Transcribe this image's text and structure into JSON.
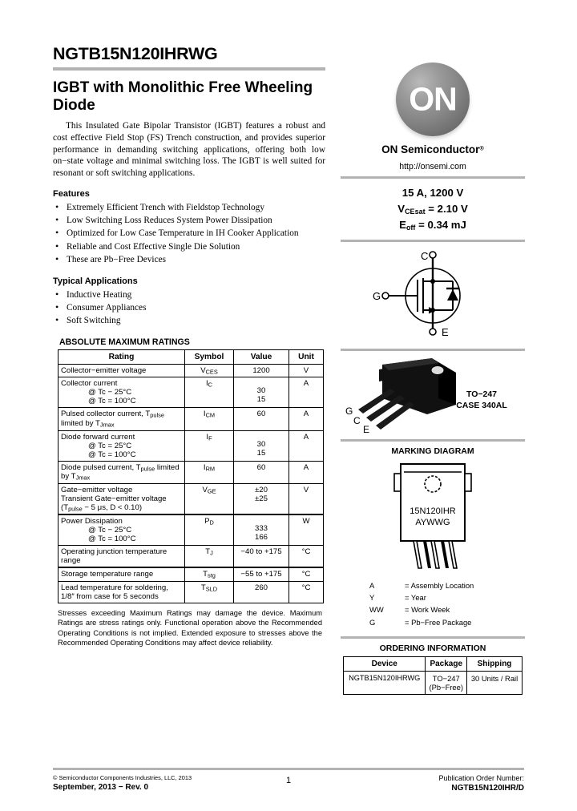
{
  "document": {
    "part_number": "NGTB15N120IHRWG",
    "title": "IGBT with Monolithic Free Wheeling Diode",
    "intro": "This Insulated Gate Bipolar Transistor (IGBT) features a robust and cost effective Field Stop (FS) Trench construction, and provides superior performance in demanding switching applications, offering both low on−state voltage and minimal switching loss. The IGBT is well suited for resonant or soft switching applications."
  },
  "features": {
    "heading": "Features",
    "items": [
      "Extremely Efficient Trench with Fieldstop Technology",
      "Low Switching Loss Reduces System Power Dissipation",
      "Optimized for Low Case Temperature in IH Cooker Application",
      "Reliable and Cost Effective Single Die Solution",
      "These are Pb−Free Devices"
    ]
  },
  "applications": {
    "heading": "Typical Applications",
    "items": [
      "Inductive Heating",
      "Consumer Appliances",
      "Soft Switching"
    ]
  },
  "ratings": {
    "heading": "ABSOLUTE MAXIMUM RATINGS",
    "columns": [
      "Rating",
      "Symbol",
      "Value",
      "Unit"
    ],
    "rows": [
      {
        "rating": "Collector−emitter voltage",
        "symbol_main": "V",
        "symbol_sub": "CES",
        "value": "1200",
        "unit": "V"
      },
      {
        "rating": "Collector current",
        "sub_lines": [
          "@ Tc − 25°C",
          "@ Tc = 100°C"
        ],
        "symbol_main": "I",
        "symbol_sub": "C",
        "values": [
          "30",
          "15"
        ],
        "unit": "A"
      },
      {
        "rating_pre": "Pulsed collector current, T",
        "rating_sub1": "pulse",
        "rating_mid": "limited by T",
        "rating_sub2": "Jmax",
        "symbol_main": "I",
        "symbol_sub": "CM",
        "value": "60",
        "unit": "A"
      },
      {
        "rating": "Diode forward current",
        "sub_lines": [
          "@ Tc = 25°C",
          "@ Tc = 100°C"
        ],
        "symbol_main": "I",
        "symbol_sub": "F",
        "values": [
          "30",
          "15"
        ],
        "unit": "A"
      },
      {
        "rating_pre": "Diode pulsed current, T",
        "rating_sub1": "pulse",
        "rating_mid2": " limited by T",
        "rating_sub2": "Jmax",
        "symbol_main": "I",
        "symbol_sub": "RM",
        "value": "60",
        "unit": "A"
      },
      {
        "rating": "Gate−emitter voltage",
        "line2": "Transient Gate−emitter voltage",
        "line3_pre": "(T",
        "line3_sub": "pulse",
        "line3_post": " − 5 μs, D < 0.10)",
        "symbol_main": "V",
        "symbol_sub": "GE",
        "values": [
          "±20",
          "±25"
        ],
        "unit": "V"
      },
      {
        "rating": "Power Dissipation",
        "sub_lines": [
          "@ Tc − 25°C",
          "@ Tc = 100°C"
        ],
        "symbol_main": "P",
        "symbol_sub": "D",
        "values": [
          "333",
          "166"
        ],
        "unit": "W"
      },
      {
        "rating": "Operating junction temperature range",
        "symbol_main": "T",
        "symbol_sub": "J",
        "value": "−40 to +175",
        "unit": "°C"
      },
      {
        "rating": "Storage temperature range",
        "symbol_main": "T",
        "symbol_sub": "stg",
        "value": "−55 to +175",
        "unit": "°C"
      },
      {
        "rating": "Lead temperature for soldering, 1/8″ from case for 5 seconds",
        "symbol_main": "T",
        "symbol_sub": "SLD",
        "value": "260",
        "unit": "°C"
      }
    ],
    "note": "Stresses exceeding Maximum Ratings may damage the device. Maximum Ratings are stress ratings only. Functional operation above the Recommended Operating Conditions is not implied. Extended exposure to stresses above the Recommended Operating Conditions may affect device reliability."
  },
  "brand": {
    "logo_text": "ON",
    "name": "ON Semiconductor",
    "registered": "®",
    "url": "http://onsemi.com"
  },
  "key_specs": {
    "line1": "15 A, 1200 V",
    "line2_pre": "V",
    "line2_sub": "CEsat",
    "line2_post": " = 2.10 V",
    "line3_pre": "E",
    "line3_sub": "off",
    "line3_post": " = 0.34 mJ"
  },
  "schematic": {
    "pin_collector": "C",
    "pin_gate": "G",
    "pin_emitter": "E"
  },
  "package": {
    "pin1": "G",
    "pin2": "C",
    "pin3": "E",
    "name": "TO−247",
    "case": "CASE 340AL"
  },
  "marking": {
    "heading": "MARKING DIAGRAM",
    "line1": "15N120IHR",
    "line2": "AYWWG",
    "legend": [
      {
        "key": "A",
        "eq": "=",
        "value": "Assembly Location"
      },
      {
        "key": "Y",
        "eq": "=",
        "value": "Year"
      },
      {
        "key": "WW",
        "eq": "=",
        "value": "Work Week"
      },
      {
        "key": "G",
        "eq": "=",
        "value": "Pb−Free Package"
      }
    ]
  },
  "ordering": {
    "heading": "ORDERING INFORMATION",
    "columns": [
      "Device",
      "Package",
      "Shipping"
    ],
    "rows": [
      {
        "device": "NGTB15N120IHRWG",
        "package_line1": "TO−247",
        "package_line2": "(Pb−Free)",
        "shipping": "30 Units / Rail"
      }
    ]
  },
  "footer": {
    "copyright": "© Semiconductor Components Industries, LLC, 2013",
    "date_rev": "September, 2013 − Rev. 0",
    "page": "1",
    "pub_label": "Publication Order Number:",
    "pub_number": "NGTB15N120IHR/D"
  },
  "colors": {
    "rule": "#b3b3b3",
    "text": "#000000",
    "background": "#ffffff"
  }
}
